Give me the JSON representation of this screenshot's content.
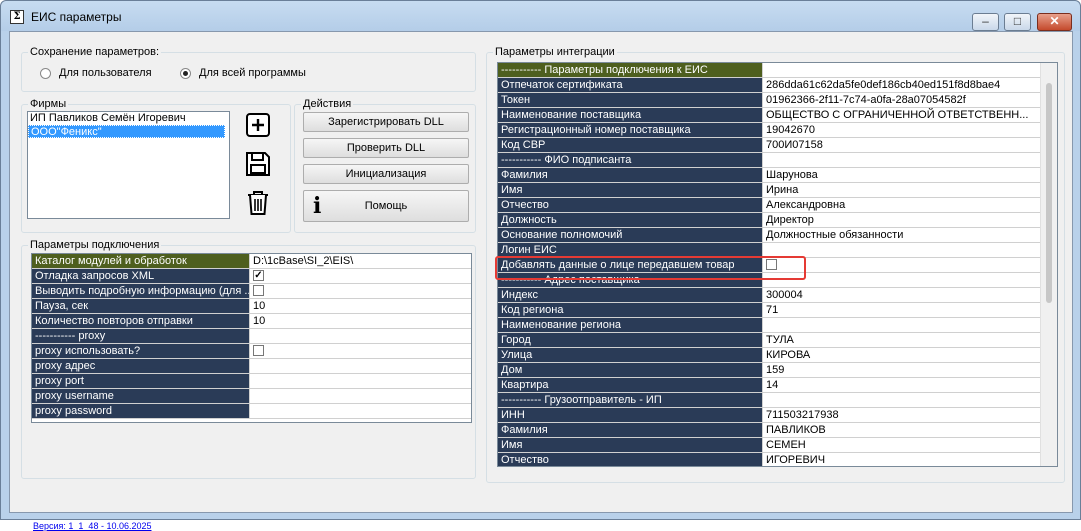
{
  "window": {
    "title": "ЕИС параметры",
    "icon_glyph": "Σ"
  },
  "titlebar_buttons": {
    "minimize": "–",
    "maximize": "□",
    "close": "✕"
  },
  "save_params": {
    "legend": "Сохранение параметров:",
    "options": [
      {
        "label": "Для пользователя",
        "selected": false
      },
      {
        "label": "Для всей программы",
        "selected": true
      }
    ]
  },
  "firms": {
    "legend": "Фирмы",
    "items": [
      "ИП Павликов Семён Игоревич",
      "ООО\"Феникс\""
    ],
    "selected_index": 1
  },
  "actions": {
    "legend": "Действия",
    "register": "Зарегистрировать DLL",
    "check": "Проверить DLL",
    "init": "Инициализация",
    "help": "Помощь"
  },
  "conn": {
    "legend": "Параметры подключения",
    "rows": [
      {
        "k": "Каталог модулей  и обработок",
        "v": "D:\\1cBase\\SI_2\\EIS\\",
        "hd": true
      },
      {
        "k": "Отладка запросов XML",
        "check": true
      },
      {
        "k": "Выводить подробную информацию (для ...",
        "check": false
      },
      {
        "k": "Пауза, сек",
        "v": "10"
      },
      {
        "k": "Количество повторов отправки",
        "v": "10"
      },
      {
        "k": "----------- proxy",
        "v": ""
      },
      {
        "k": "proxy использовать?",
        "check": false
      },
      {
        "k": "proxy адрес",
        "v": ""
      },
      {
        "k": "proxy port",
        "v": ""
      },
      {
        "k": "proxy username",
        "v": ""
      },
      {
        "k": "proxy password",
        "v": ""
      }
    ]
  },
  "integ": {
    "legend": "Параметры интеграции",
    "rows": [
      {
        "k": "----------- Параметры подключения к ЕИС",
        "v": "",
        "hd": true
      },
      {
        "k": "Отпечаток сертификата",
        "v": "286dda61c62da5fe0def186cb40ed151f8d8bae4"
      },
      {
        "k": "Токен",
        "v": "01962366-2f11-7c74-a0fa-28a07054582f"
      },
      {
        "k": "Наименование поставщика",
        "v": "ОБЩЕСТВО С ОГРАНИЧЕННОЙ ОТВЕТСТВЕНН..."
      },
      {
        "k": "Регистрационный номер поставщика",
        "v": "19042670"
      },
      {
        "k": "Код СВР",
        "v": "700И07158"
      },
      {
        "k": "----------- ФИО подписанта",
        "v": ""
      },
      {
        "k": "Фамилия",
        "v": "Шарунова"
      },
      {
        "k": "Имя",
        "v": "Ирина"
      },
      {
        "k": "Отчество",
        "v": "Александровна"
      },
      {
        "k": "Должность",
        "v": "Директор"
      },
      {
        "k": "Основание полномочий",
        "v": "Должностные обязанности"
      },
      {
        "k": "Логин ЕИС",
        "v": ""
      },
      {
        "k": "Добавлять данные о лице передавшем товар",
        "check": false
      },
      {
        "k": "----------- Адрес поставщика",
        "v": ""
      },
      {
        "k": "Индекс",
        "v": "300004"
      },
      {
        "k": "Код региона",
        "v": "71"
      },
      {
        "k": "Наименование региона",
        "v": ""
      },
      {
        "k": "Город",
        "v": "ТУЛА"
      },
      {
        "k": "Улица",
        "v": "КИРОВА"
      },
      {
        "k": "Дом",
        "v": "159"
      },
      {
        "k": "Квартира",
        "v": "14"
      },
      {
        "k": "----------- Грузоотправитель - ИП",
        "v": ""
      },
      {
        "k": "ИНН",
        "v": "711503217938"
      },
      {
        "k": "Фамилия",
        "v": "ПАВЛИКОВ"
      },
      {
        "k": "Имя",
        "v": "СЕМЕН"
      },
      {
        "k": "Отчество",
        "v": "ИГОРЕВИЧ"
      }
    ]
  },
  "version": "Версия: 1_1_48 - 10.06.2025",
  "colors": {
    "grid_key_bg": "#2a3b57",
    "grid_header_bg": "#4e5f1e",
    "selection": "#3399ff",
    "highlight": "#e53a34"
  }
}
